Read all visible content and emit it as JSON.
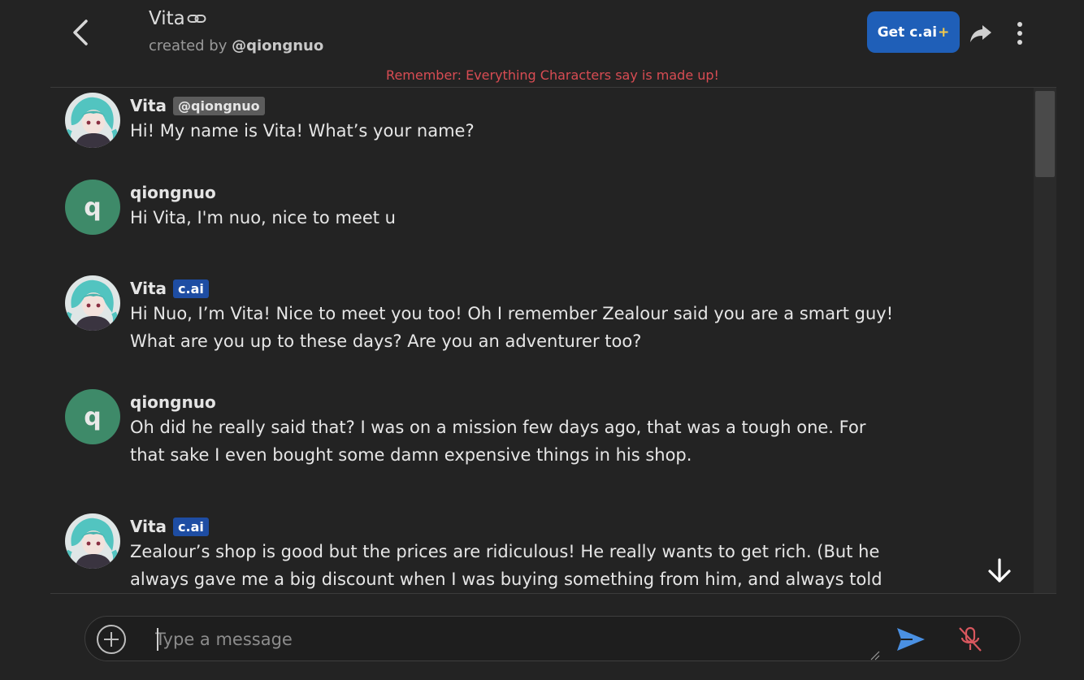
{
  "header": {
    "char_name": "Vita",
    "created_by_prefix": "created by",
    "creator_handle": "@qiongnuo",
    "get_plus_label": "Get c.ai",
    "get_plus_suffix": "+",
    "disclaimer": "Remember: Everything Characters say is made up!"
  },
  "messages": [
    {
      "name": "Vita",
      "badge": "@qiongnuo",
      "text": "Hi! My name is Vita! What’s your name?"
    },
    {
      "name": "qiongnuo",
      "avatar_letter": "q",
      "text": "Hi Vita, I'm nuo, nice to meet u"
    },
    {
      "name": "Vita",
      "badge": "c.ai",
      "text_lines": [
        "Hi Nuo, I’m Vita! Nice to meet you too! Oh I remember Zealour said you are a smart guy!",
        "What are you up to these days? Are you an adventurer too?"
      ]
    },
    {
      "name": "qiongnuo",
      "avatar_letter": "q",
      "text_lines": [
        "Oh did he really said that? I was on a mission few days ago, that was a tough one. For",
        "that sake I even bought some damn expensive things in his shop."
      ]
    },
    {
      "name": "Vita",
      "badge": "c.ai",
      "text_lines": [
        "Zealour’s shop is good but the prices are ridiculous! He really wants to get rich. (But he",
        "always gave me a big discount when I was buying something from him, and always told"
      ]
    }
  ],
  "composer": {
    "placeholder": "Type a message"
  },
  "colors": {
    "accent": "#1f5fb8",
    "disclaimer": "#d84c53",
    "user_avatar": "#3e8a69",
    "mic_muted": "#d8575e",
    "send": "#4a90e2"
  }
}
